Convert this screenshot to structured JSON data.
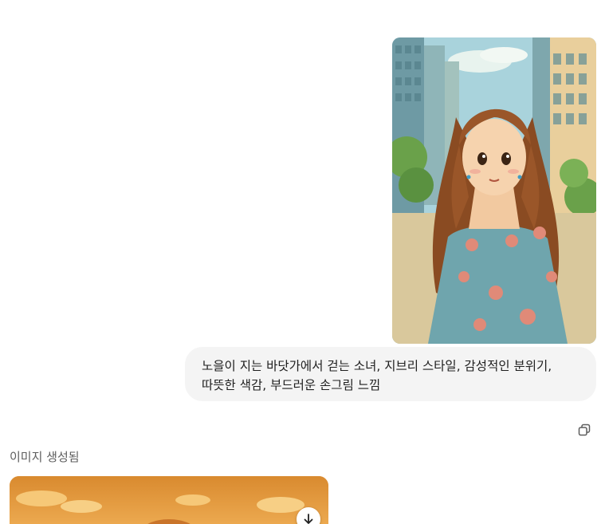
{
  "conversation": {
    "user_message": {
      "image_icon": "anime-girl-city-image",
      "text": "노을이 지는 바닷가에서 걷는 소녀, 지브리 스타일, 감성적인 분위기, 따뜻한 색감, 부드러운 손그림 느낌"
    },
    "actions": {
      "copy_icon": "copy-icon"
    },
    "assistant_message": {
      "status": "이미지 생성됨",
      "image_icon": "sunset-sky-image",
      "download_icon": "download-arrow-icon"
    }
  },
  "colors": {
    "bubble_bg": "#f4f4f4",
    "status_text": "#5d5d5d",
    "sunset_orange": "#e59a3c"
  }
}
